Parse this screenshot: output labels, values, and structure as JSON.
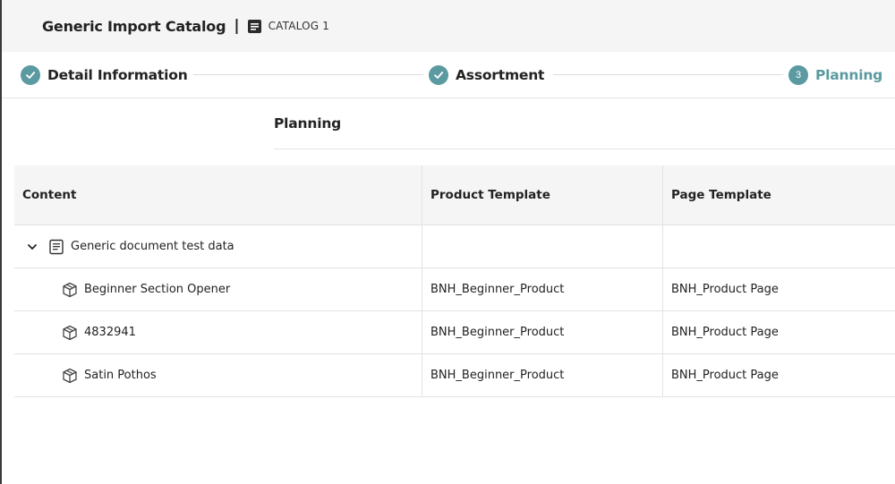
{
  "header": {
    "app_title": "Generic Import Catalog",
    "separator": "|",
    "catalog_icon": "document-icon",
    "catalog_name": "CATALOG 1"
  },
  "stepper": {
    "steps": [
      {
        "number": "1",
        "label": "Detail Information",
        "status": "done",
        "icon": "check-icon"
      },
      {
        "number": "2",
        "label": "Assortment",
        "status": "done",
        "icon": "check-icon"
      },
      {
        "number": "3",
        "label": "Planning",
        "status": "active"
      }
    ]
  },
  "section": {
    "title": "Planning"
  },
  "table": {
    "columns": [
      "Content",
      "Product Template",
      "Page Template"
    ],
    "group": {
      "label": "Generic document test data",
      "expand_icon": "chevron-down-icon",
      "icon": "document-icon"
    },
    "rows": [
      {
        "content": "Beginner Section Opener",
        "product_template": "BNH_Beginner_Product",
        "page_template": "BNH_Product Page",
        "icon": "box-icon"
      },
      {
        "content": "4832941",
        "product_template": "BNH_Beginner_Product",
        "page_template": "BNH_Product Page",
        "icon": "box-icon"
      },
      {
        "content": "Satin Pothos",
        "product_template": "BNH_Beginner_Product",
        "page_template": "BNH_Product Page",
        "icon": "box-icon"
      }
    ]
  },
  "colors": {
    "accent": "#5b9aa0",
    "header_bg": "#f5f5f5",
    "border": "#e2e2e2"
  }
}
